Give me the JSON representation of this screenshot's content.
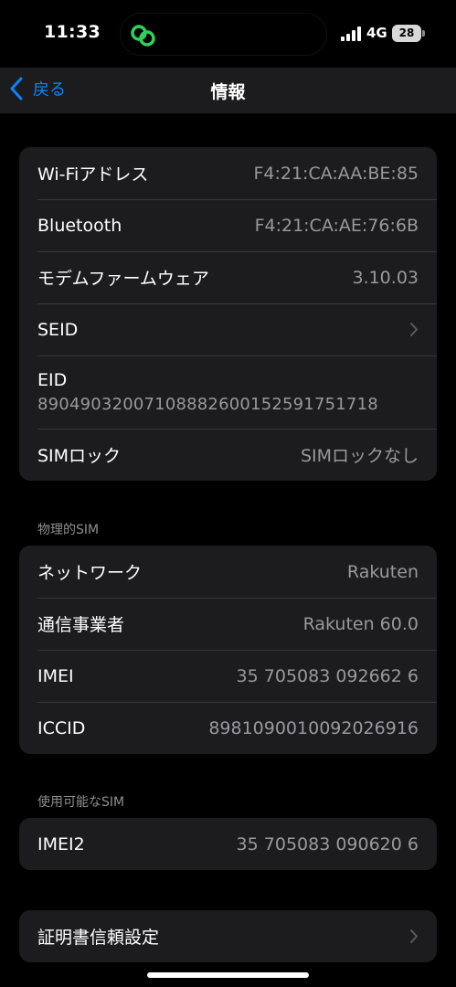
{
  "status_bar": {
    "time": "11:33",
    "network": "4G",
    "battery": "28"
  },
  "nav": {
    "back_label": "戻る",
    "title": "情報"
  },
  "group1": {
    "rows": [
      {
        "label": "Wi-Fiアドレス",
        "value": "F4:21:CA:AA:BE:85"
      },
      {
        "label": "Bluetooth",
        "value": "F4:21:CA:AE:76:6B"
      },
      {
        "label": "モデムファームウェア",
        "value": "3.10.03"
      },
      {
        "label": "SEID"
      },
      {
        "label": "EID",
        "value": "89049032007108882600152591751718"
      },
      {
        "label": "SIMロック",
        "value": "SIMロックなし"
      }
    ]
  },
  "physical_sim": {
    "header": "物理的SIM",
    "rows": [
      {
        "label": "ネットワーク",
        "value": "Rakuten"
      },
      {
        "label": "通信事業者",
        "value": "Rakuten 60.0"
      },
      {
        "label": "IMEI",
        "value": "35 705083 092662 6"
      },
      {
        "label": "ICCID",
        "value": "8981090010092026916"
      }
    ]
  },
  "available_sim": {
    "header": "使用可能なSIM",
    "rows": [
      {
        "label": "IMEI2",
        "value": "35 705083 090620 6"
      }
    ]
  },
  "certificates": {
    "label": "証明書信頼設定"
  },
  "colors": {
    "accent": "#0a84ff",
    "island_icon": "#30d158"
  }
}
